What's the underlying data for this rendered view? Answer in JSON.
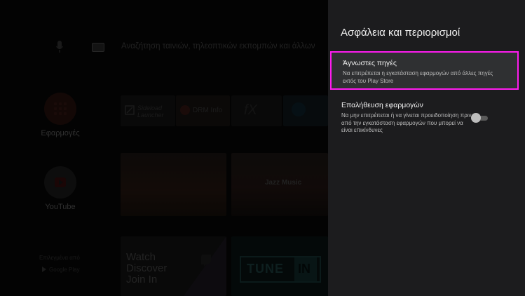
{
  "home": {
    "search_placeholder": "Αναζήτηση ταινιών, τηλεοπτικών εκπομπών και άλλων",
    "sidebar": [
      {
        "label": "Εφαρμογές",
        "icon": "apps-icon",
        "color": "#3d1812"
      },
      {
        "label": "YouTube",
        "icon": "youtube-icon",
        "color": "#2c2c2c"
      }
    ],
    "recommended_by": "Επιλεγμένα από",
    "google_play": "Google Play",
    "tiles": {
      "sideload": "Sideload Launcher",
      "drm_info": "DRM Info",
      "jazz_music": "Jazz Music",
      "watch_lines": [
        "Watch",
        "Discover",
        "Join In"
      ],
      "tune": "TUNE",
      "in": "IN"
    }
  },
  "panel": {
    "title": "Ασφάλεια και περιορισμοί",
    "options": [
      {
        "title": "Άγνωστες πηγές",
        "subtitle": "Να επιτρέπεται η εγκατάσταση εφαρμογών από άλλες πηγές εκτός του Play Store",
        "selected": true
      },
      {
        "title": "Επαλήθευση εφαρμογών",
        "subtitle": "Να μην επιτρέπεται ή να γίνεται προειδοποίηση πριν από την εγκατάσταση εφαρμογών που μπορεί να είναι επικίνδυνες",
        "toggle_on": false
      }
    ],
    "highlight_color": "#ff1cf0"
  }
}
